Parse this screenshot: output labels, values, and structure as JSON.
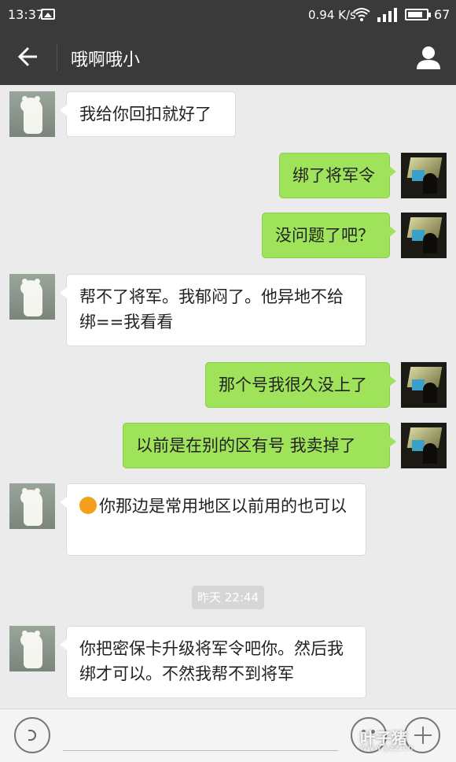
{
  "status_bar": {
    "time": "13:37",
    "network_speed": "0.94 K/s",
    "battery": "67",
    "icons": [
      "gallery-icon",
      "wifi-icon",
      "signal-icon",
      "battery-icon"
    ]
  },
  "header": {
    "title": "哦啊哦小",
    "icons": [
      "back-arrow-icon",
      "user-profile-icon"
    ]
  },
  "messages": [
    {
      "side": "in",
      "text": "我给你回扣就好了"
    },
    {
      "side": "out",
      "text": "绑了将军令"
    },
    {
      "side": "out",
      "text": "没问题了吧？"
    },
    {
      "side": "in",
      "text": "帮不了将军。我郁闷了。他异地不给绑==我看看"
    },
    {
      "side": "out",
      "text": "那个号我很久没上了"
    },
    {
      "side": "out",
      "text": "以前是在别的区有号 我卖掉了"
    },
    {
      "side": "in",
      "emoji": "grin-emoji",
      "text": "你那边是常用地区以前用的也可以"
    },
    {
      "side": "in",
      "text": "你把密保卡升级将军令吧你。然后我绑才可以。不然我帮不到将军"
    }
  ],
  "timestamp": "昨天 22:44",
  "bottom_bar": {
    "icons": [
      "voice-icon",
      "emoji-icon",
      "plus-icon"
    ]
  },
  "watermark": {
    "text": "叶子猪",
    "sub": "www.yzz.cn"
  },
  "colors": {
    "header_bg": "#3a3a3a",
    "chat_bg": "#ebebeb",
    "out_bubble": "#9fe35a",
    "in_bubble": "#ffffff"
  }
}
